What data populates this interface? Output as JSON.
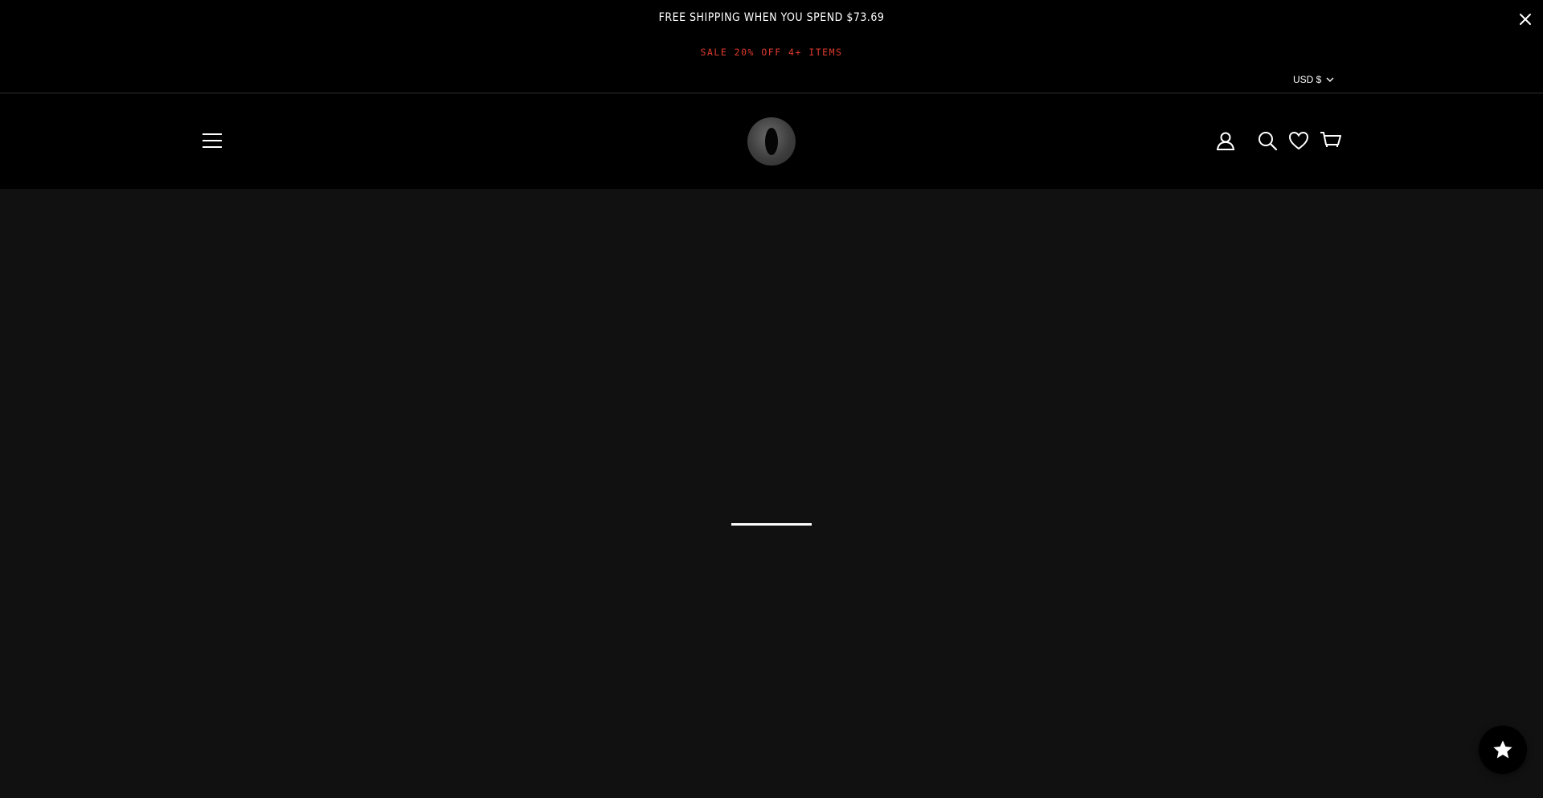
{
  "announcement": {
    "shipping_text": "FREE SHIPPING WHEN YOU SPEND $73.69",
    "sale_text": "SALE 20% OFF 4+ ITEMS",
    "sale_color": "#e03b2e"
  },
  "currency": {
    "label": "USD $"
  },
  "header": {
    "logo_name": "ring-logo",
    "icons": [
      "menu-icon",
      "account-icon",
      "search-icon",
      "wishlist-icon",
      "cart-icon"
    ]
  },
  "floating": {
    "icon": "star-icon"
  },
  "colors": {
    "background": "#111111",
    "header": "#000000",
    "accent": "#e03b2e"
  }
}
